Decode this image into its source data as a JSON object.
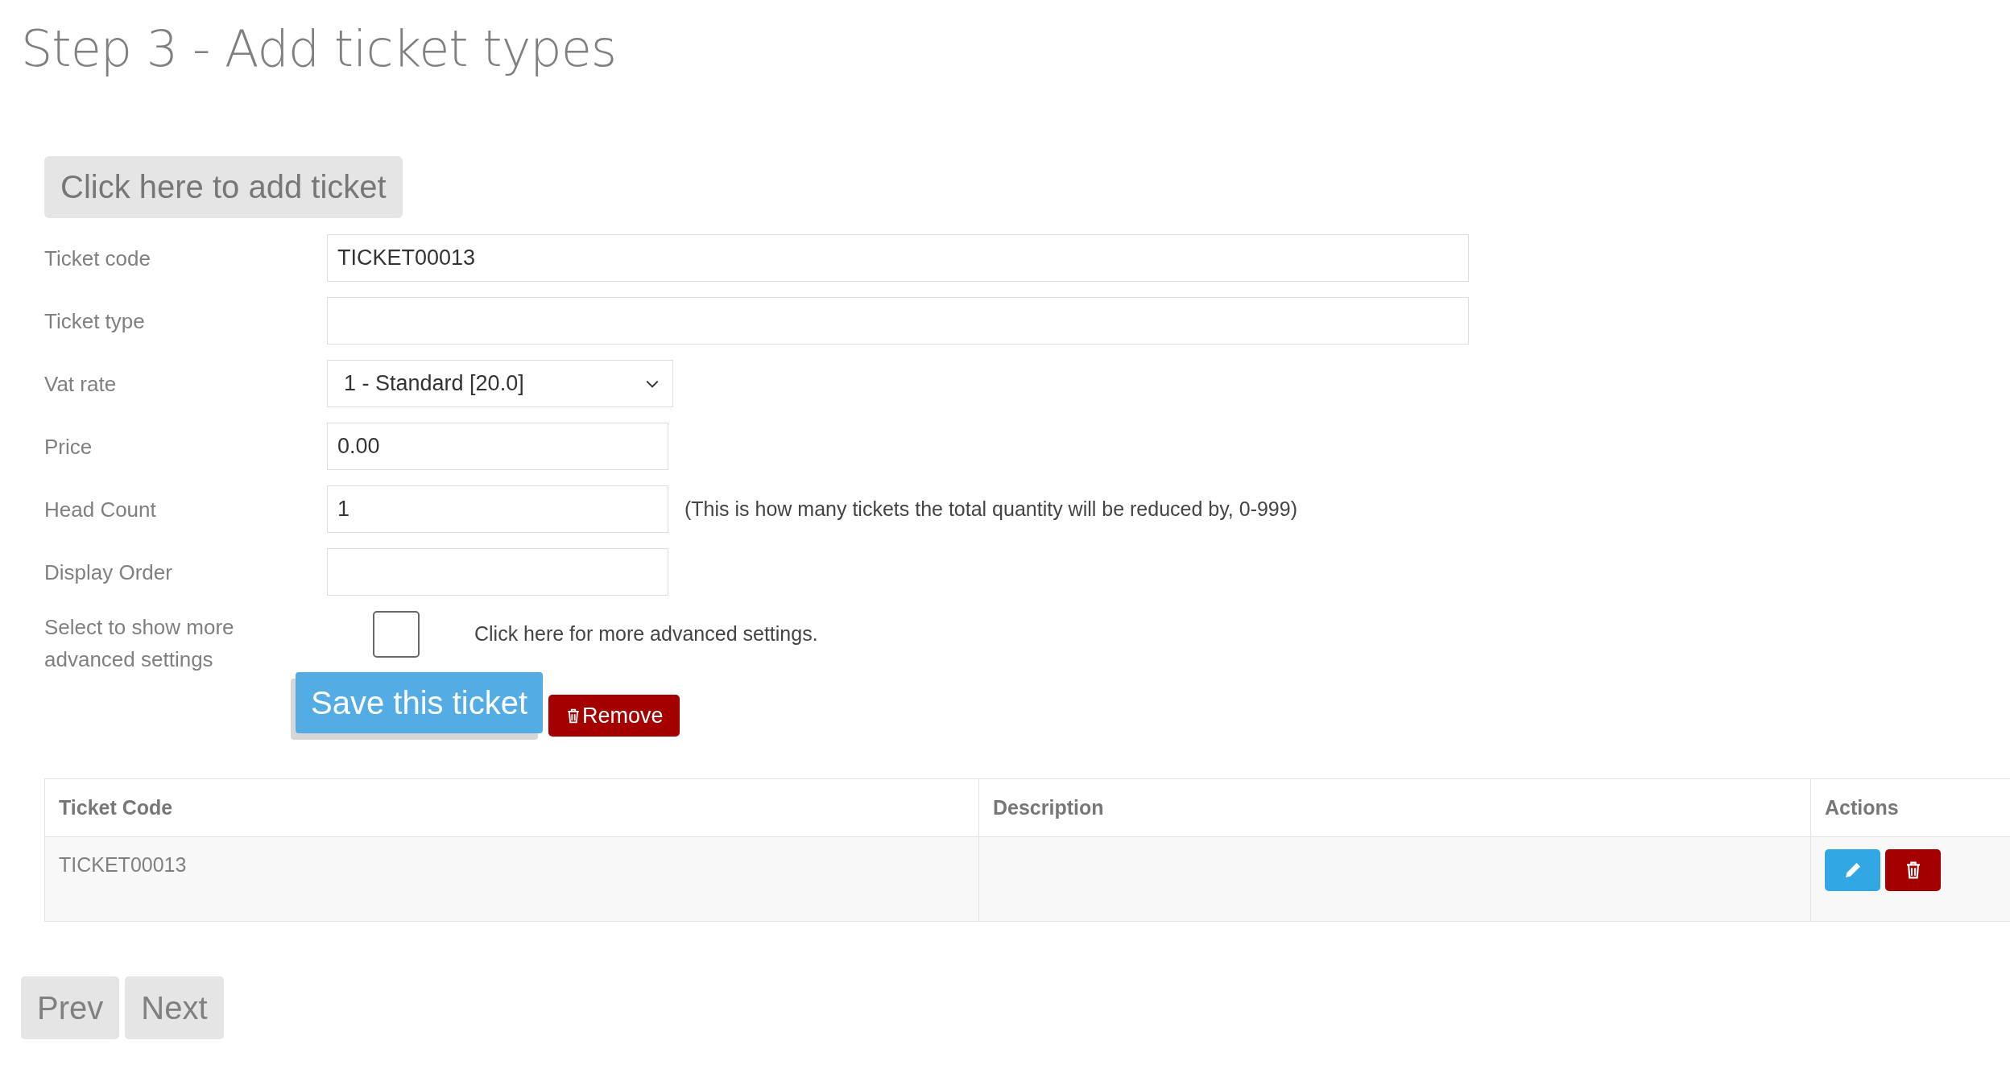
{
  "page_title": "Step 3 - Add ticket types",
  "add_button": "Click here to add ticket",
  "form": {
    "fields": [
      {
        "kind": "wide_text",
        "label": "Ticket code",
        "value": "TICKET00013"
      },
      {
        "kind": "wide_text",
        "label": "Ticket type"
      },
      {
        "kind": "select",
        "label": "Vat rate",
        "value": "1 - Standard [20.0]"
      },
      {
        "kind": "short_text",
        "label": "Price",
        "value": "0.00"
      },
      {
        "kind": "short_text",
        "label": "Head Count",
        "value": "1",
        "help": "(This is how many tickets the total quantity will be reduced by, 0-999)"
      },
      {
        "kind": "short_text",
        "label": "Display Order"
      },
      {
        "kind": "checkbox",
        "label": "Select to show more advanced settings",
        "checked": false,
        "help": "Click here for more advanced settings."
      }
    ],
    "save_button": "Save this ticket",
    "remove_button": "Remove"
  },
  "table": {
    "columns": [
      "Ticket Code",
      "Description",
      "Actions"
    ],
    "rows": [
      {
        "ticket_code": "TICKET00013"
      }
    ]
  },
  "pager": [
    "Prev",
    "Next"
  ]
}
